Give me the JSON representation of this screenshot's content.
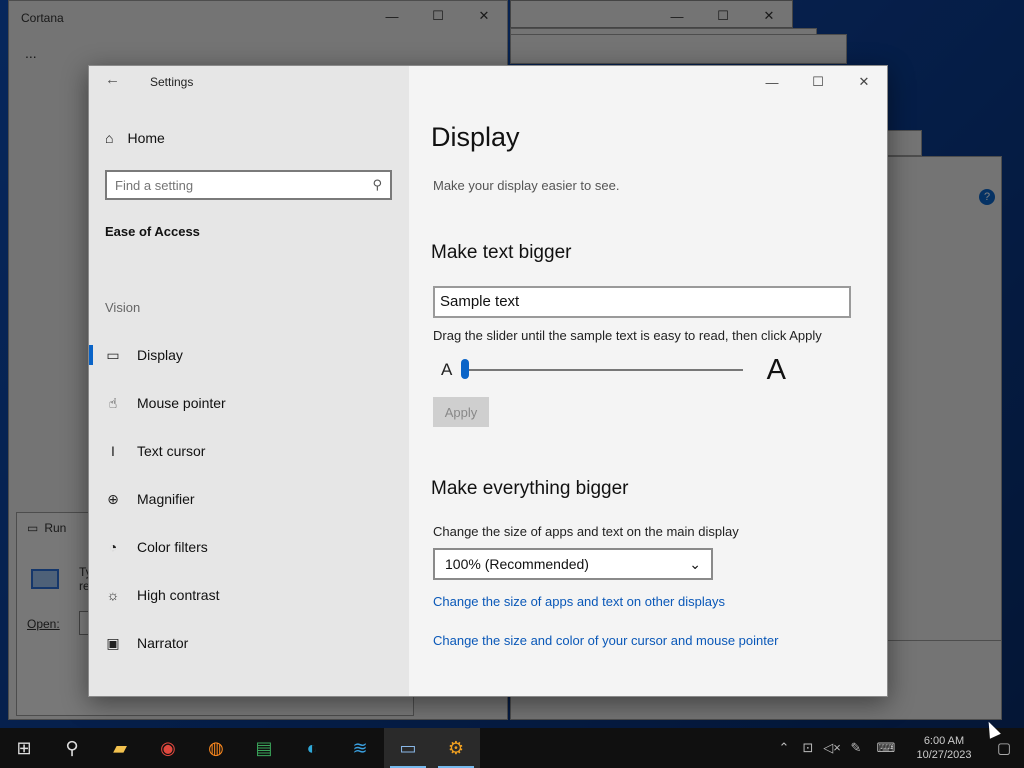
{
  "background_windows": {
    "cortana_title": "Cortana",
    "cortana_more": "...",
    "run_title": "Run",
    "run_text_1": "Ty",
    "run_text_2": "re",
    "run_open_label": "Open:"
  },
  "settings": {
    "window_title": "Settings",
    "back_icon": "arrow-left-icon",
    "controls": {
      "minimize": "—",
      "maximize": "☐",
      "close": "✕"
    },
    "sidebar": {
      "home_label": "Home",
      "search_placeholder": "Find a setting",
      "category": "Ease of Access",
      "section": "Vision",
      "items": [
        {
          "label": "Display",
          "icon": "monitor-icon",
          "active": true
        },
        {
          "label": "Mouse pointer",
          "icon": "mouse-pointer-icon",
          "active": false
        },
        {
          "label": "Text cursor",
          "icon": "text-cursor-icon",
          "active": false
        },
        {
          "label": "Magnifier",
          "icon": "magnifier-icon",
          "active": false
        },
        {
          "label": "Color filters",
          "icon": "palette-icon",
          "active": false
        },
        {
          "label": "High contrast",
          "icon": "sun-icon",
          "active": false
        },
        {
          "label": "Narrator",
          "icon": "narrator-icon",
          "active": false
        }
      ]
    },
    "content": {
      "title": "Display",
      "subtitle": "Make your display easier to see.",
      "make_text_bigger": "Make text bigger",
      "sample_text": "Sample text",
      "slider_hint": "Drag the slider until the sample text is easy to read, then click Apply",
      "slider_small_label": "A",
      "slider_large_label": "A",
      "slider_value": 0,
      "apply_label": "Apply",
      "make_everything_bigger": "Make everything bigger",
      "scale_label": "Change the size of apps and text on the main display",
      "scale_value": "100% (Recommended)",
      "link_other_displays": "Change the size of apps and text on other displays",
      "link_cursor": "Change the size and color of your cursor and mouse pointer"
    }
  },
  "taskbar": {
    "apps": [
      {
        "name": "start-icon",
        "glyph": "⊞"
      },
      {
        "name": "search-icon",
        "glyph": "⚲"
      },
      {
        "name": "file-explorer-icon",
        "glyph": "▰"
      },
      {
        "name": "chrome-icon",
        "glyph": "◉"
      },
      {
        "name": "firefox-icon",
        "glyph": "◍"
      },
      {
        "name": "spreadsheet-icon",
        "glyph": "▤"
      },
      {
        "name": "edge-icon",
        "glyph": "◐"
      },
      {
        "name": "monitor-app-icon",
        "glyph": "≋"
      },
      {
        "name": "run-app-icon",
        "glyph": "▭"
      },
      {
        "name": "settings-gear-icon",
        "glyph": "⚙"
      }
    ],
    "time": "6:00 AM",
    "date": "10/27/2023"
  },
  "colors": {
    "accent": "#0a64c8",
    "link": "#0a58b8",
    "settings_gear": "#f0a020"
  }
}
